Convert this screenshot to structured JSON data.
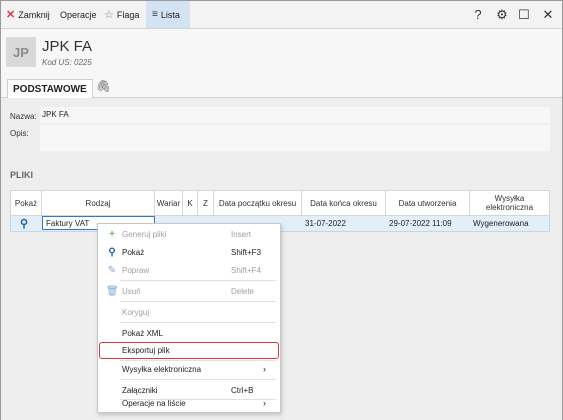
{
  "toolbar": {
    "close_label": "Zamknij",
    "operations_label": "Operacje",
    "flag_label": "Flaga",
    "list_label": "Lista",
    "help_glyph": "?",
    "settings_glyph": "⚙",
    "maximize_glyph": "☐",
    "close_window_glyph": "✕"
  },
  "header": {
    "avatar": "JP",
    "title": "JPK FA",
    "subtitle": "Kod US: 0225"
  },
  "tabs": {
    "active": "PODSTAWOWE"
  },
  "form": {
    "name_label": "Nazwa:",
    "name_value": "JPK FA",
    "description_label": "Opis:",
    "description_value": ""
  },
  "section": {
    "title": "PLIKI"
  },
  "table": {
    "columns": [
      "Pokaż",
      "Rodzaj",
      "Wariar",
      "K",
      "Z",
      "Data początku okresu",
      "Data końca okresu",
      "Data utworzenia",
      "Wysyłka elektroniczna"
    ],
    "rows": [
      {
        "type": "Faktury VAT",
        "variant": "",
        "k": "",
        "z": "",
        "start": "",
        "end": "31-07-2022",
        "created": "29-07-2022 11:09",
        "sending": "Wygenerowana"
      }
    ]
  },
  "context_menu": {
    "items": [
      {
        "label": "Generuj pliki",
        "shortcut": "Insert",
        "icon": "plus-icon",
        "disabled": true
      },
      {
        "label": "Pokaż",
        "shortcut": "Shift+F3",
        "icon": "search-icon",
        "disabled": false
      },
      {
        "label": "Popraw",
        "shortcut": "Shift+F4",
        "icon": "pencil-icon",
        "disabled": true
      },
      {
        "label": "Usuń",
        "shortcut": "Delete",
        "icon": "trash-icon",
        "disabled": true
      },
      {
        "label": "Koryguj",
        "shortcut": "",
        "icon": "",
        "disabled": true
      },
      {
        "label": "Pokaż XML",
        "shortcut": "",
        "icon": "",
        "disabled": false
      },
      {
        "label": "Eksportuj plik",
        "shortcut": "",
        "icon": "",
        "disabled": false,
        "highlighted": true
      },
      {
        "label": "Wysyłka elektroniczna",
        "shortcut": "",
        "icon": "",
        "disabled": false,
        "submenu": true
      },
      {
        "label": "Załączniki",
        "shortcut": "Ctrl+B",
        "icon": "",
        "disabled": false
      },
      {
        "label": "Operacje na liście",
        "shortcut": "",
        "icon": "",
        "disabled": false,
        "submenu": true
      }
    ]
  },
  "colors": {
    "accent_red": "#d9363e",
    "selection_blue": "#d3e3f3",
    "row_selected": "#e4eef8",
    "icon_blue": "#1f5fa8"
  }
}
